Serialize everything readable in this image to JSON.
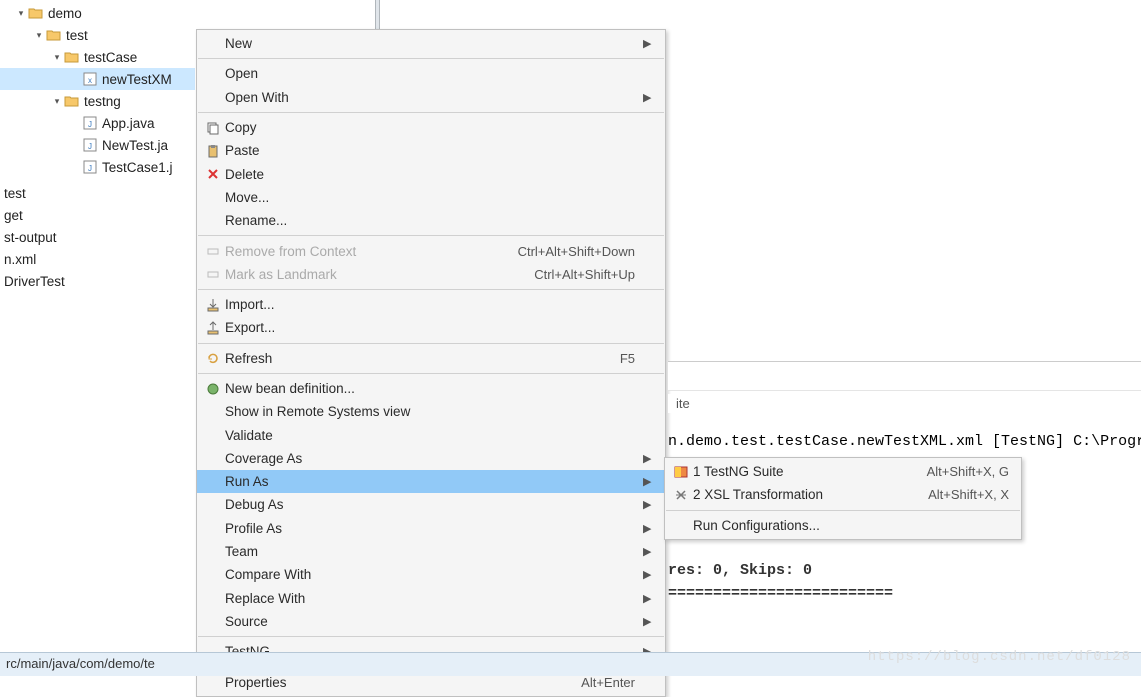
{
  "tree": {
    "items": [
      {
        "indent": 0,
        "expander": "▾",
        "icon": "folder",
        "label": "demo"
      },
      {
        "indent": 1,
        "expander": "▾",
        "icon": "folder",
        "label": "test"
      },
      {
        "indent": 2,
        "expander": "▾",
        "icon": "folder",
        "label": "testCase"
      },
      {
        "indent": 3,
        "expander": "",
        "icon": "xml",
        "label": "newTestXM",
        "selected": true
      },
      {
        "indent": 2,
        "expander": "▾",
        "icon": "folder",
        "label": "testng"
      },
      {
        "indent": 3,
        "expander": "",
        "icon": "java",
        "label": "App.java"
      },
      {
        "indent": 3,
        "expander": "",
        "icon": "java",
        "label": "NewTest.ja"
      },
      {
        "indent": 3,
        "expander": "",
        "icon": "java",
        "label": "TestCase1.j"
      }
    ],
    "roots": [
      "test",
      "get",
      "st-output",
      "n.xml",
      "DriverTest"
    ]
  },
  "menu": [
    {
      "label": "New",
      "arrow": true
    },
    {
      "sep": true
    },
    {
      "label": "Open"
    },
    {
      "label": "Open With",
      "arrow": true
    },
    {
      "sep": true
    },
    {
      "icon": "copy",
      "label": "Copy"
    },
    {
      "icon": "paste",
      "label": "Paste"
    },
    {
      "icon": "delete",
      "label": "Delete"
    },
    {
      "label": "Move..."
    },
    {
      "label": "Rename..."
    },
    {
      "sep": true
    },
    {
      "icon": "remove-context",
      "label": "Remove from Context",
      "shortcut": "Ctrl+Alt+Shift+Down",
      "disabled": true
    },
    {
      "icon": "landmark",
      "label": "Mark as Landmark",
      "shortcut": "Ctrl+Alt+Shift+Up",
      "disabled": true
    },
    {
      "sep": true
    },
    {
      "icon": "import",
      "label": "Import..."
    },
    {
      "icon": "export",
      "label": "Export..."
    },
    {
      "sep": true
    },
    {
      "icon": "refresh",
      "label": "Refresh",
      "shortcut": "F5"
    },
    {
      "sep": true
    },
    {
      "icon": "bean",
      "label": "New bean definition..."
    },
    {
      "label": "Show in Remote Systems view"
    },
    {
      "label": "Validate"
    },
    {
      "label": "Coverage As",
      "arrow": true
    },
    {
      "label": "Run As",
      "arrow": true,
      "highlighted": true
    },
    {
      "label": "Debug As",
      "arrow": true
    },
    {
      "label": "Profile As",
      "arrow": true
    },
    {
      "label": "Team",
      "arrow": true
    },
    {
      "label": "Compare With",
      "arrow": true
    },
    {
      "label": "Replace With",
      "arrow": true
    },
    {
      "label": "Source",
      "arrow": true
    },
    {
      "sep": true
    },
    {
      "label": "TestNG",
      "arrow": true
    },
    {
      "sep": true
    },
    {
      "label": "Properties",
      "shortcut": "Alt+Enter"
    }
  ],
  "submenu": [
    {
      "icon": "testng",
      "label": "1 TestNG Suite",
      "shortcut": "Alt+Shift+X, G"
    },
    {
      "icon": "xsl",
      "label": "2 XSL Transformation",
      "shortcut": "Alt+Shift+X, X"
    },
    {
      "sep": true
    },
    {
      "label": "Run Configurations..."
    }
  ],
  "tab": {
    "label": "ite"
  },
  "console": {
    "line1": "n.demo.test.testCase.newTestXML.xml [TestNG] C:\\Program Files",
    "line2": "res: 0, Skips: 0",
    "line3": "========================="
  },
  "statusbar": "rc/main/java/com/demo/te",
  "watermark": "https://blog.csdn.net/df0128"
}
